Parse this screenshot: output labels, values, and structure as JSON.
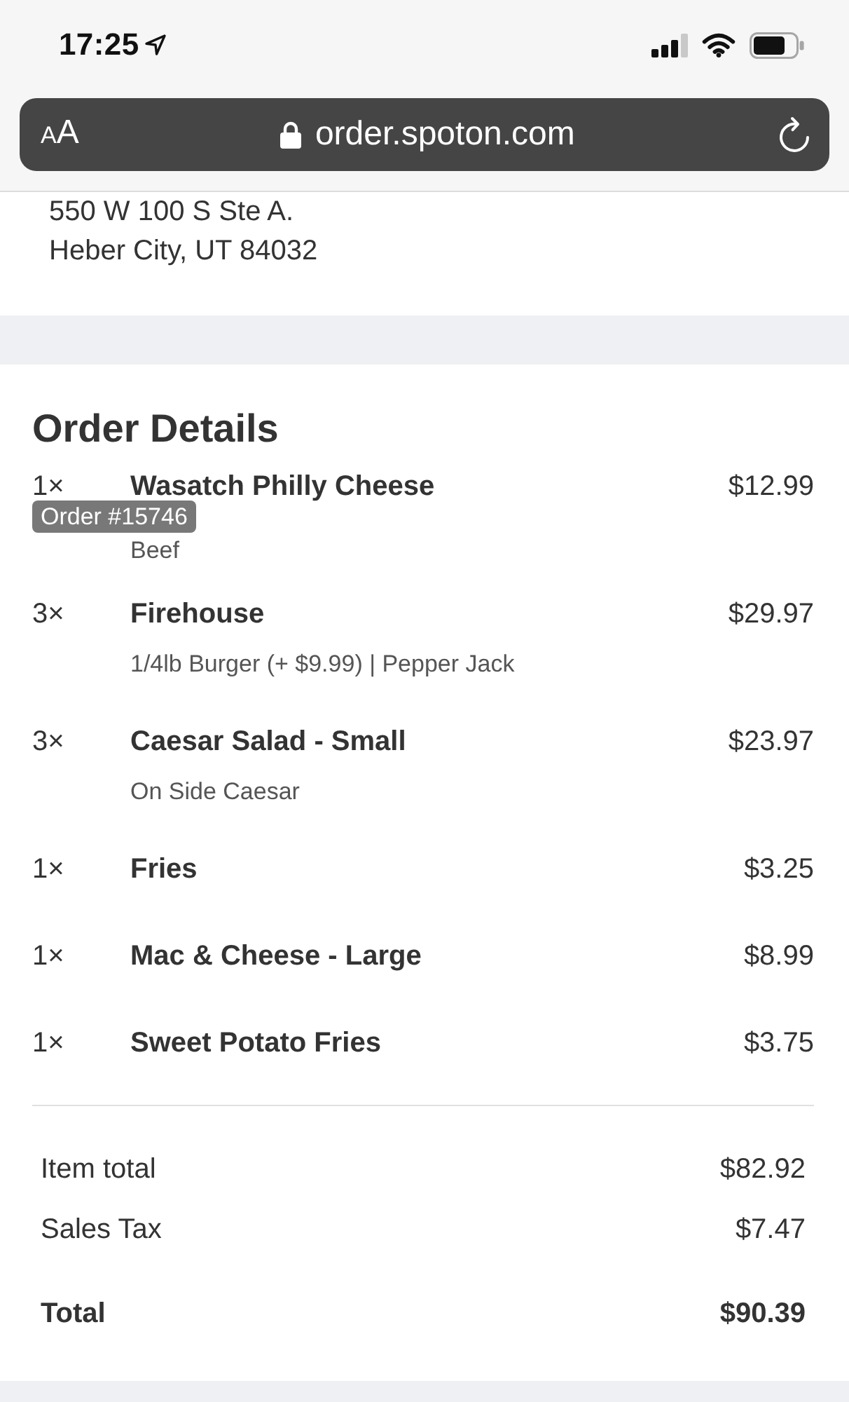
{
  "status_bar": {
    "time": "17:25"
  },
  "browser_bar": {
    "text_size_label": "AA",
    "url": "order.spoton.com"
  },
  "address": {
    "lines": [
      "550 W 100 S Ste A.",
      "Heber City, UT 84032"
    ]
  },
  "order": {
    "title": "Order Details",
    "badge": "Order #15746",
    "items": [
      {
        "qty": "1×",
        "name": "Wasatch Philly Cheese",
        "options": "Beef",
        "price": "$12.99"
      },
      {
        "qty": "3×",
        "name": "Firehouse",
        "options": "1/4lb Burger (+ $9.99) | Pepper Jack",
        "price": "$29.97"
      },
      {
        "qty": "3×",
        "name": "Caesar Salad - Small",
        "options": "On Side Caesar",
        "price": "$23.97"
      },
      {
        "qty": "1×",
        "name": "Fries",
        "price": "$3.25"
      },
      {
        "qty": "1×",
        "name": "Mac & Cheese - Large",
        "price": "$8.99"
      },
      {
        "qty": "1×",
        "name": "Sweet Potato Fries",
        "price": "$3.75"
      }
    ]
  },
  "summary": [
    {
      "kind": "subtotal",
      "label": "Item total",
      "amount": "$82.92"
    },
    {
      "kind": "subtotal",
      "label": "Sales Tax",
      "amount": "$7.47"
    },
    {
      "kind": "grand",
      "label": "Total",
      "amount": "$90.39"
    }
  ]
}
